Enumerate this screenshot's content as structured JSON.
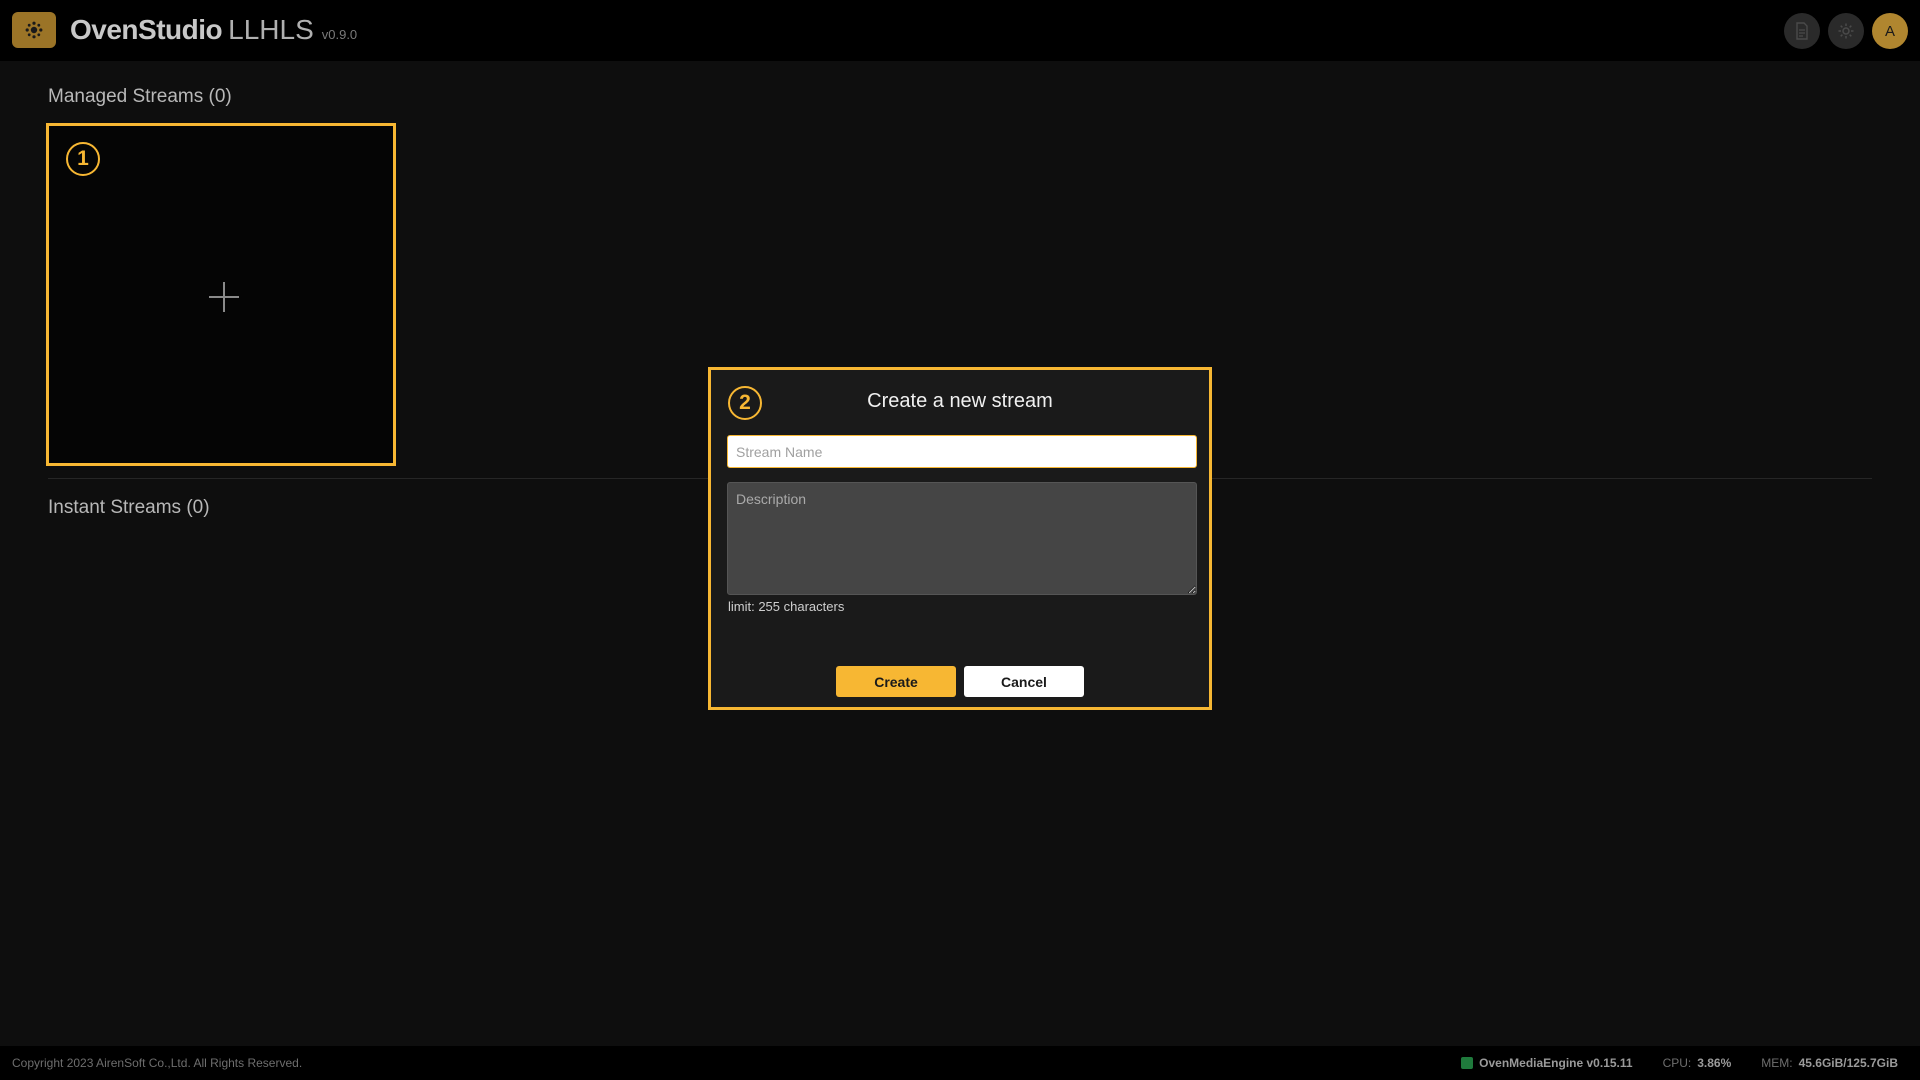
{
  "header": {
    "brand_name": "OvenStudio",
    "brand_product": "LLHLS",
    "brand_version": "v0.9.0",
    "avatar_initial": "A"
  },
  "managed": {
    "title": "Managed Streams (0)",
    "badge": "1"
  },
  "instant": {
    "title": "Instant Streams (0)"
  },
  "modal": {
    "badge": "2",
    "title": "Create a new stream",
    "name_placeholder": "Stream Name",
    "name_value": "",
    "description_placeholder": "Description",
    "description_value": "",
    "limit_text": "limit: 255 characters",
    "create_label": "Create",
    "cancel_label": "Cancel"
  },
  "footer": {
    "copyright": "Copyright 2023 AirenSoft Co.,Ltd. All Rights Reserved.",
    "engine": "OvenMediaEngine v0.15.11",
    "cpu_label": "CPU:",
    "cpu_value": "3.86%",
    "mem_label": "MEM:",
    "mem_value": "45.6GiB/125.7GiB"
  },
  "colors": {
    "accent": "#f7b733",
    "engine_status": "#1f7a3c"
  }
}
